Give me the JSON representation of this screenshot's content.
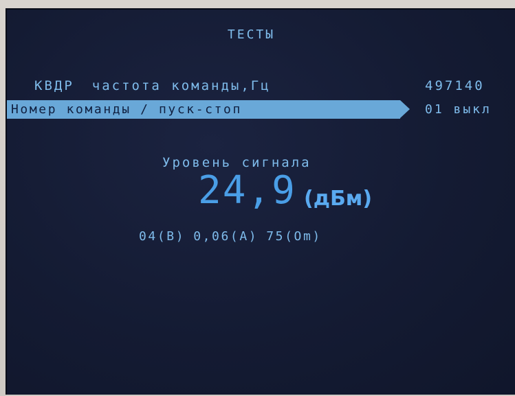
{
  "screen": {
    "title": "ТЕСТЫ",
    "rows": [
      {
        "label_a": "КВДР",
        "label_b": "частота команды,Гц",
        "value": "497140"
      },
      {
        "label": "Номер команды / пуск-стоп",
        "value": "01 выкл",
        "selected": true
      }
    ],
    "signal": {
      "label": "Уровень сигнала",
      "value": "24,9",
      "unit": "(дБм)"
    },
    "measurements": [
      "04(В)",
      "0,06(А)",
      "75(Оm)"
    ]
  },
  "colors": {
    "screen_bg": "#141b33",
    "text": "#7fbcec",
    "highlight_bar": "#69a8d8",
    "highlight_text": "#102040",
    "big_value": "#4a9ee6"
  }
}
